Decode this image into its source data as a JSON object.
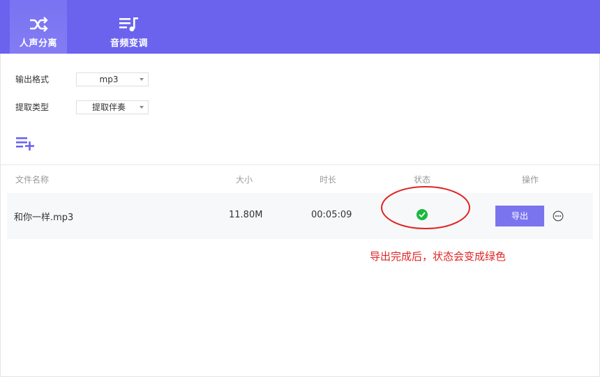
{
  "header": {
    "tabs": [
      {
        "label": "人声分离",
        "icon": "shuffle-icon",
        "active": true
      },
      {
        "label": "音频变调",
        "icon": "music-list-icon",
        "active": false
      }
    ],
    "bg_color": "#6b63ee"
  },
  "form": {
    "format_label": "输出格式",
    "format_value": "mp3",
    "type_label": "提取类型",
    "type_value": "提取伴奏",
    "add_icon": "add-list-icon"
  },
  "table": {
    "headers": [
      "文件名称",
      "大小",
      "时长",
      "状态",
      "操作"
    ],
    "rows": [
      {
        "name": "和你一样.mp3",
        "size": "11.80M",
        "duration": "00:05:09",
        "status": "check-icon",
        "action": "导出",
        "more_icon": "more-icon"
      }
    ]
  },
  "annotation": {
    "text": "导出完成后，状态会变成绿色",
    "color": "#e02424"
  },
  "colors": {
    "accent": "#7b74ef",
    "success": "#19b93b"
  }
}
